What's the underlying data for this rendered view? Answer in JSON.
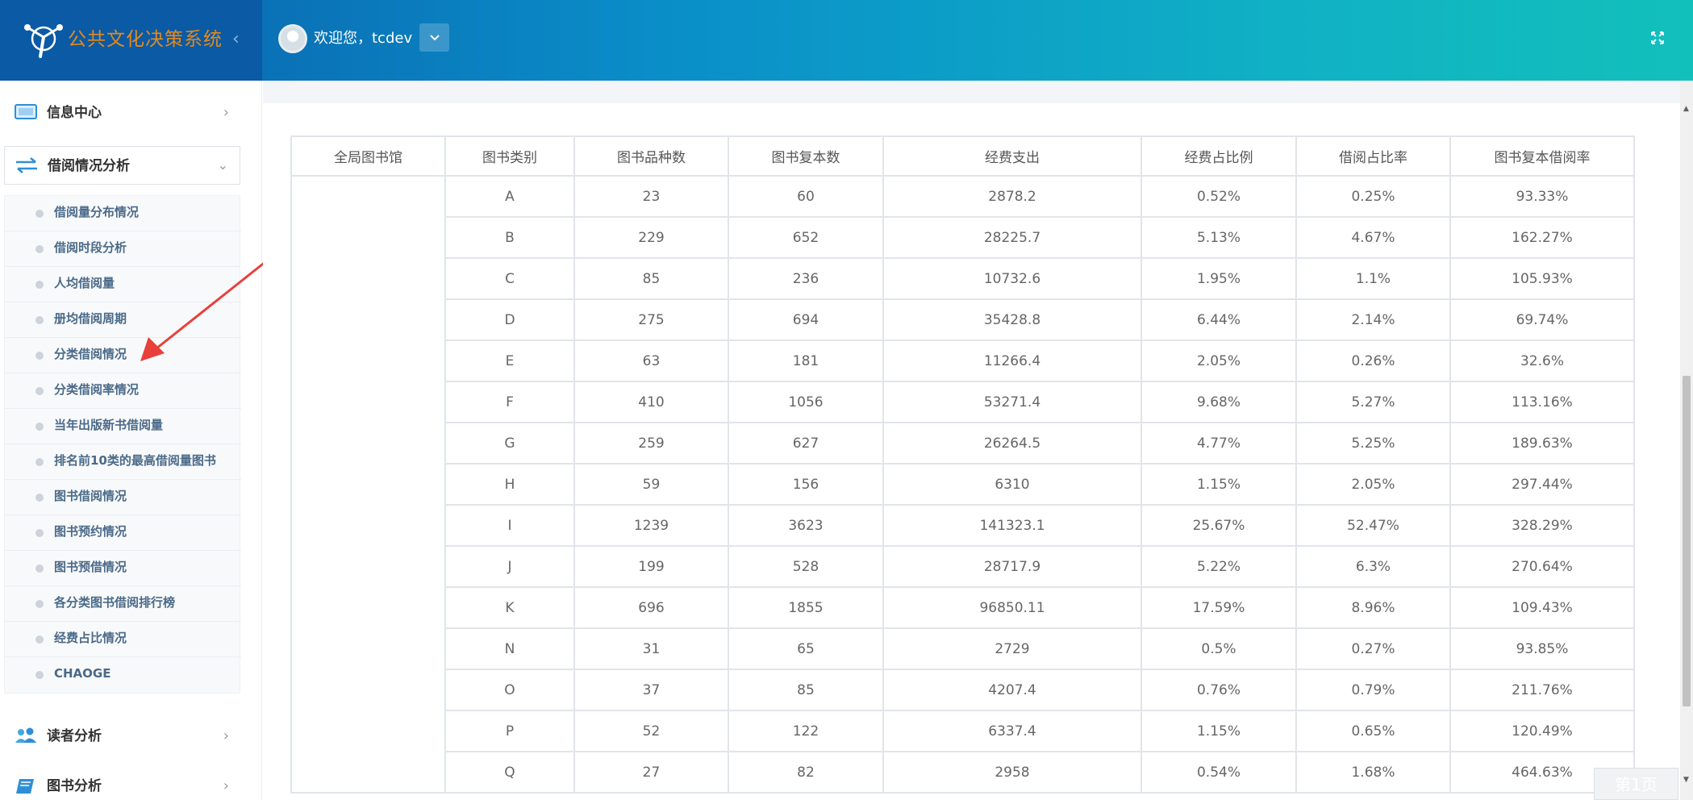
{
  "header": {
    "title": "公共文化决策系统",
    "collapse_icon": "‹",
    "welcome": "欢迎您，tcdev",
    "dropdown_icon": "⌄",
    "fullscreen_icon": "⤧"
  },
  "sidebar": {
    "info_center": {
      "label": "信息中心",
      "chevron": "›"
    },
    "borrow_analysis": {
      "label": "借阅情况分析",
      "chevron": "⌄"
    },
    "sub_items": [
      "借阅量分布情况",
      "借阅时段分析",
      "人均借阅量",
      "册均借阅周期",
      "分类借阅情况",
      "分类借阅率情况",
      "当年出版新书借阅量",
      "排名前10类的最高借阅量图书",
      "图书借阅情况",
      "图书预约情况",
      "图书预借情况",
      "各分类图书借阅排行榜",
      "经费占比情况",
      "CHAOGE"
    ],
    "reader_analysis": {
      "label": "读者分析",
      "chevron": "›"
    },
    "book_analysis": {
      "label": "图书分析",
      "chevron": "›"
    }
  },
  "table": {
    "headers": [
      "全局图书馆",
      "图书类别",
      "图书品种数",
      "图书复本数",
      "经费支出",
      "经费占比例",
      "借阅占比率",
      "图书复本借阅率"
    ],
    "library": "",
    "rows": [
      [
        "A",
        "23",
        "60",
        "2878.2",
        "0.52%",
        "0.25%",
        "93.33%"
      ],
      [
        "B",
        "229",
        "652",
        "28225.7",
        "5.13%",
        "4.67%",
        "162.27%"
      ],
      [
        "C",
        "85",
        "236",
        "10732.6",
        "1.95%",
        "1.1%",
        "105.93%"
      ],
      [
        "D",
        "275",
        "694",
        "35428.8",
        "6.44%",
        "2.14%",
        "69.74%"
      ],
      [
        "E",
        "63",
        "181",
        "11266.4",
        "2.05%",
        "0.26%",
        "32.6%"
      ],
      [
        "F",
        "410",
        "1056",
        "53271.4",
        "9.68%",
        "5.27%",
        "113.16%"
      ],
      [
        "G",
        "259",
        "627",
        "26264.5",
        "4.77%",
        "5.25%",
        "189.63%"
      ],
      [
        "H",
        "59",
        "156",
        "6310",
        "1.15%",
        "2.05%",
        "297.44%"
      ],
      [
        "I",
        "1239",
        "3623",
        "141323.1",
        "25.67%",
        "52.47%",
        "328.29%"
      ],
      [
        "J",
        "199",
        "528",
        "28717.9",
        "5.22%",
        "6.3%",
        "270.64%"
      ],
      [
        "K",
        "696",
        "1855",
        "96850.11",
        "17.59%",
        "8.96%",
        "109.43%"
      ],
      [
        "N",
        "31",
        "65",
        "2729",
        "0.5%",
        "0.27%",
        "93.85%"
      ],
      [
        "O",
        "37",
        "85",
        "4207.4",
        "0.76%",
        "0.79%",
        "211.76%"
      ],
      [
        "P",
        "52",
        "122",
        "6337.4",
        "1.15%",
        "0.65%",
        "120.49%"
      ],
      [
        "Q",
        "27",
        "82",
        "2958",
        "0.54%",
        "1.68%",
        "464.63%"
      ]
    ]
  },
  "float_box": {
    "label": "第1页"
  },
  "colors": {
    "brand": "#0b5aa5",
    "title": "#e48a1c",
    "header_end": "#12c0bb",
    "annotation": "#e8403a",
    "submenu_text": "#4a6a88"
  }
}
